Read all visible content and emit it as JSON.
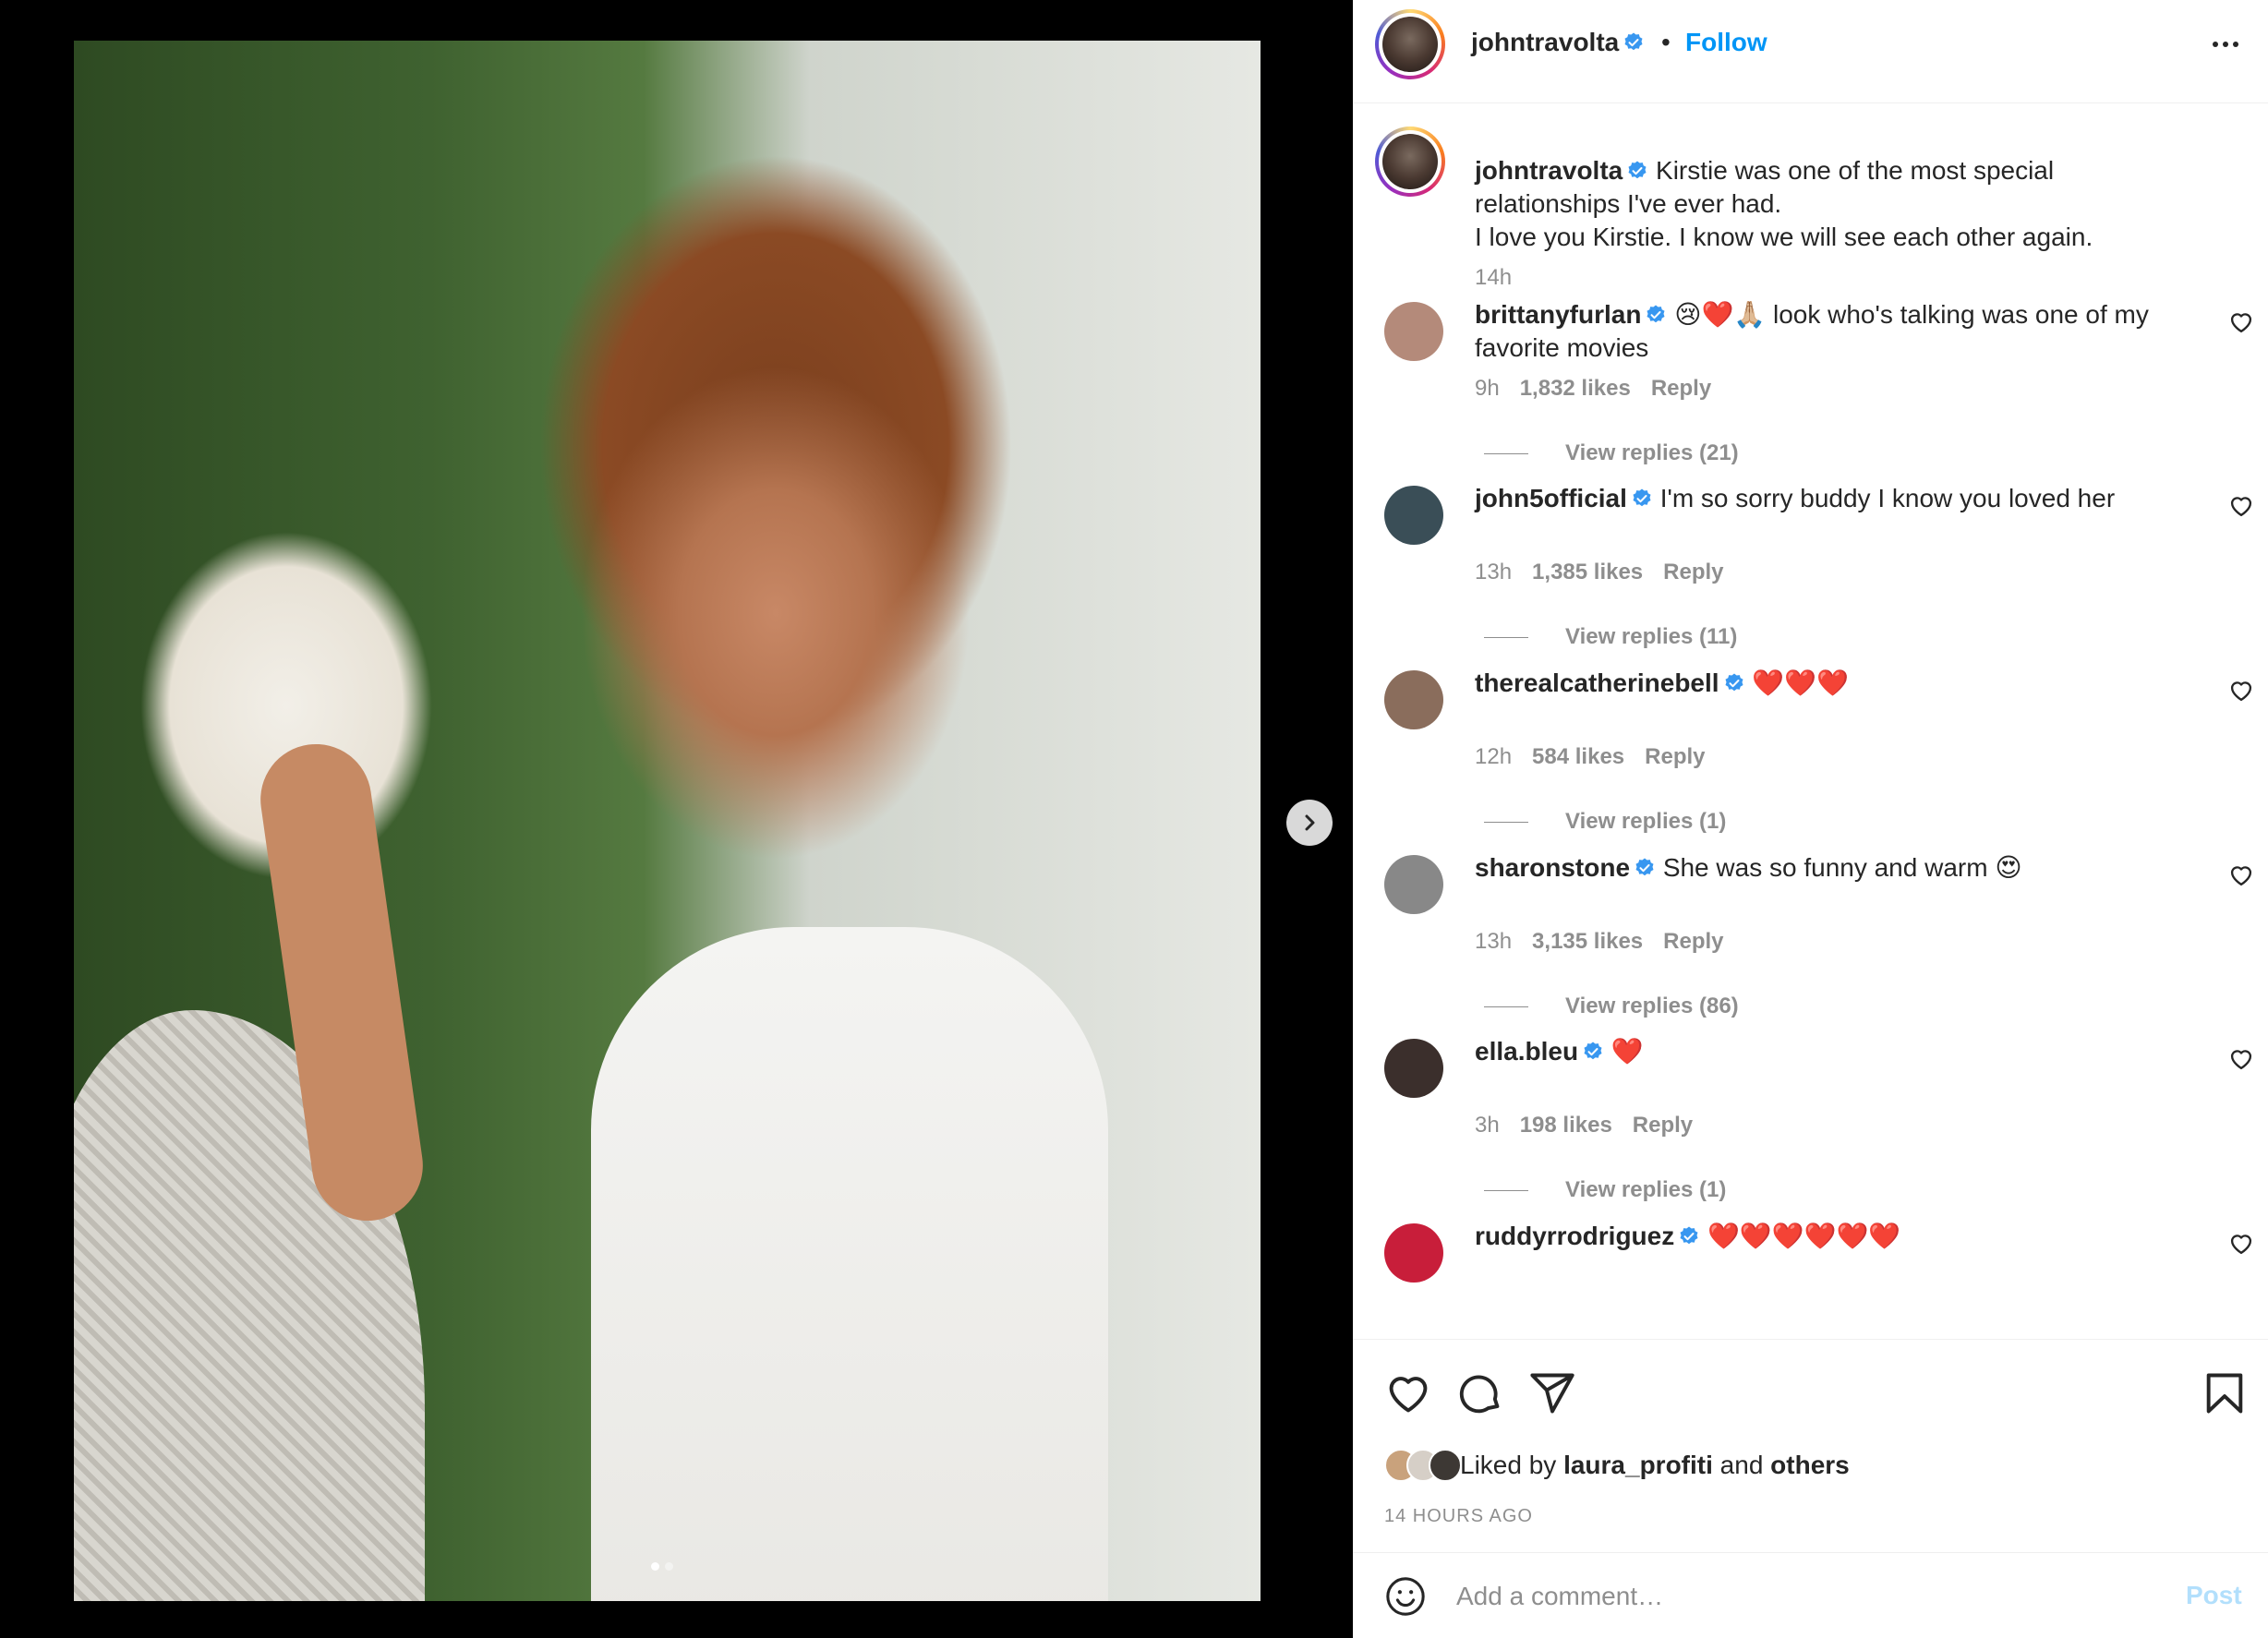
{
  "post": {
    "username": "johntravolta",
    "follow_label": "Follow",
    "separator": "•",
    "caption": "Kirstie was one of the most special relationships I've ever had.\nI love you Kirstie. I know we will see each other again.",
    "caption_time": "14h"
  },
  "comments": [
    {
      "username": "brittanyfurlan",
      "emoji": "😢",
      "hearts": "❤️",
      "emoji2": "🙏🏼",
      "text": " look who's talking was one of my favorite movies",
      "time": "9h",
      "likes": "1,832 likes",
      "reply": "Reply",
      "view_replies": "View replies (21)",
      "avatar_color": "#b48a7a"
    },
    {
      "username": "john5official",
      "text": "I'm so sorry buddy I know you loved her",
      "time": "13h",
      "likes": "1,385 likes",
      "reply": "Reply",
      "view_replies": "View replies (11)",
      "avatar_color": "#3a4e57"
    },
    {
      "username": "therealcatherinebell",
      "hearts": "❤️❤️❤️",
      "time": "12h",
      "likes": "584 likes",
      "reply": "Reply",
      "view_replies": "View replies (1)",
      "avatar_color": "#8a6d5c"
    },
    {
      "username": "sharonstone",
      "text": "She was so funny and warm ",
      "emoji": "😍",
      "time": "13h",
      "likes": "3,135 likes",
      "reply": "Reply",
      "view_replies": "View replies (86)",
      "avatar_color": "#888888"
    },
    {
      "username": "ella.bleu",
      "hearts": "❤️",
      "time": "3h",
      "likes": "198 likes",
      "reply": "Reply",
      "view_replies": "View replies (1)",
      "avatar_color": "#3b2f2c"
    },
    {
      "username": "ruddyrrodriguez",
      "hearts": "❤️❤️❤️❤️❤️❤️",
      "avatar_color": "#c81e3a"
    }
  ],
  "footer": {
    "liked_prefix": "Liked by ",
    "liked_user": "laura_profiti",
    "liked_and": " and ",
    "liked_others": "others",
    "time_ago": "14 HOURS AGO",
    "comment_placeholder": "Add a comment…",
    "post_label": "Post"
  },
  "carousel": {
    "current": 1,
    "total": 2
  },
  "icons": [
    "verified-badge-icon",
    "more-icon",
    "next-arrow-icon",
    "heart-icon",
    "comment-icon",
    "share-icon",
    "bookmark-icon",
    "emoji-icon"
  ],
  "colors": {
    "link": "#0095f6",
    "verified": "#3897f0",
    "muted": "#8e8e8e",
    "post_disabled": "#b2dffc"
  }
}
